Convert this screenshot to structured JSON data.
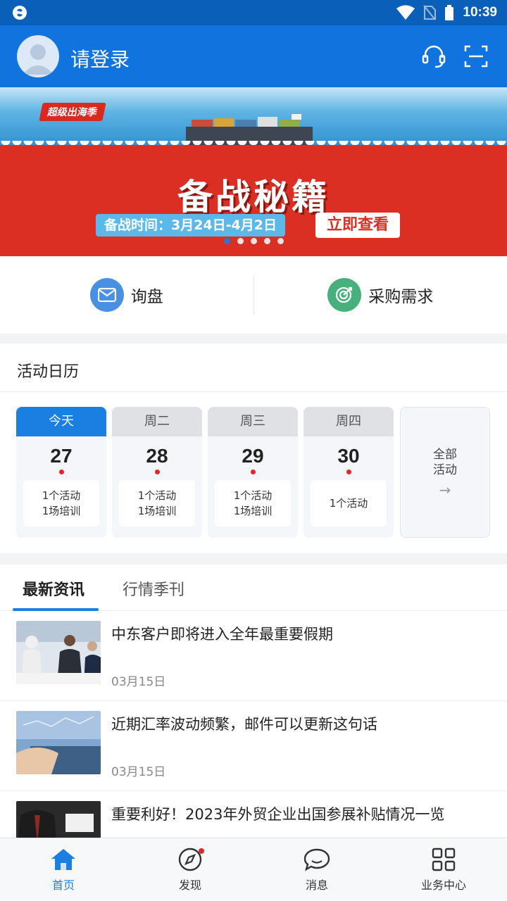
{
  "status_bar": {
    "time": "10:39"
  },
  "header": {
    "login_text": "请登录"
  },
  "banner": {
    "tag": "超级出海季",
    "title": "备战秘籍",
    "time_text": "备战时间：3月24日-4月2日",
    "cta": "立即查看",
    "dot_count": 5,
    "active_dot": 0
  },
  "quick_actions": [
    {
      "label": "询盘",
      "icon": "mail-icon",
      "color": "#4a90e2"
    },
    {
      "label": "采购需求",
      "icon": "target-icon",
      "color": "#47b07c"
    }
  ],
  "calendar": {
    "title": "活动日历",
    "days": [
      {
        "weekday": "今天",
        "date": "27",
        "line1": "1个活动",
        "line2": "1场培训",
        "today": true
      },
      {
        "weekday": "周二",
        "date": "28",
        "line1": "1个活动",
        "line2": "1场培训"
      },
      {
        "weekday": "周三",
        "date": "29",
        "line1": "1个活动",
        "line2": "1场培训"
      },
      {
        "weekday": "周四",
        "date": "30",
        "line1": "1个活动",
        "line2": ""
      }
    ],
    "all": {
      "line1": "全部",
      "line2": "活动",
      "arrow": "→"
    }
  },
  "news": {
    "tabs": [
      "最新资讯",
      "行情季刊"
    ],
    "active_tab": 0,
    "items": [
      {
        "title": "中东客户即将进入全年最重要假期",
        "date": "03月15日"
      },
      {
        "title": "近期汇率波动频繁，邮件可以更新这句话",
        "date": "03月15日"
      },
      {
        "title": "重要利好！2023年外贸企业出国参展补贴情况一览",
        "date": ""
      }
    ]
  },
  "bottom_nav": [
    {
      "label": "首页",
      "icon": "home-icon",
      "active": true
    },
    {
      "label": "发现",
      "icon": "compass-icon",
      "badge": true
    },
    {
      "label": "消息",
      "icon": "chat-icon"
    },
    {
      "label": "业务中心",
      "icon": "grid-icon"
    }
  ],
  "colors": {
    "primary": "#1173dd",
    "accent": "#1a7fe0",
    "banner_red": "#dc2f23",
    "badge": "#e0272d"
  }
}
